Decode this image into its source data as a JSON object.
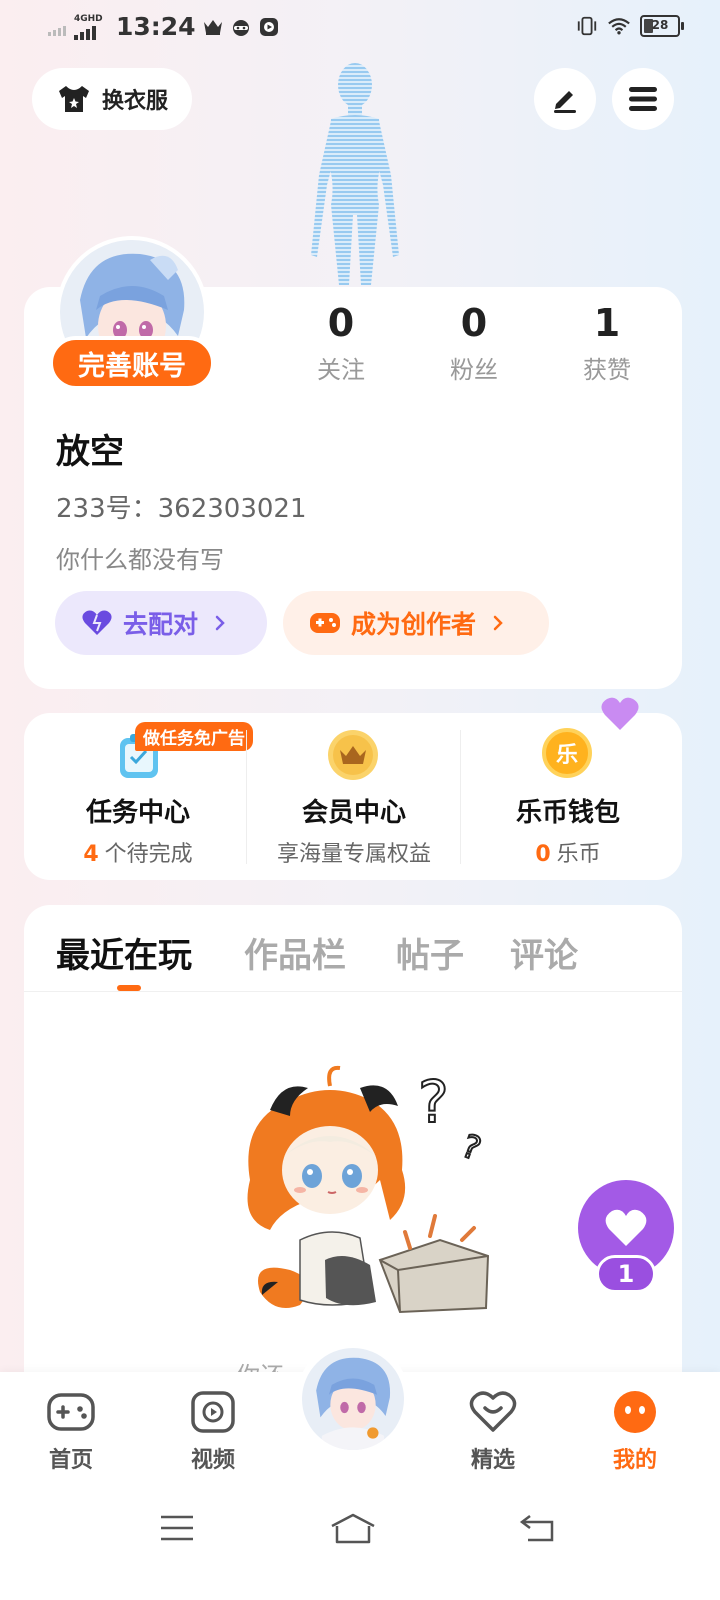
{
  "status_bar": {
    "network_type": "4GHD",
    "time": "13:24",
    "battery": "28",
    "icons": [
      "crown-icon",
      "ninja-icon",
      "play-icon",
      "vibrate-icon",
      "wifi-icon",
      "battery-icon"
    ]
  },
  "top_actions": {
    "outfit_label": "换衣服",
    "edit_icon": "pen-icon",
    "menu_icon": "menu-icon"
  },
  "profile": {
    "complete_badge": "完善账号",
    "stats": [
      {
        "value": "0",
        "label": "关注"
      },
      {
        "value": "0",
        "label": "粉丝"
      },
      {
        "value": "1",
        "label": "获赞"
      }
    ],
    "username": "放空",
    "uid": "233号：362303021",
    "bio": "你什么都没有写",
    "pair_label": "去配对",
    "creator_label": "成为创作者"
  },
  "services": {
    "task_badge": "做任务免广告",
    "items": [
      {
        "title": "任务中心",
        "count": "4",
        "sub": "个待完成"
      },
      {
        "title": "会员中心",
        "count": "",
        "sub": "享海量专属权益"
      },
      {
        "title": "乐币钱包",
        "count": "0",
        "sub": "乐币"
      }
    ],
    "coin_glyph": "乐"
  },
  "tabs": [
    "最近在玩",
    "作品栏",
    "帖子",
    "评论"
  ],
  "active_tab": 0,
  "empty_state_partial": "你还",
  "floating_like": {
    "count": "1"
  },
  "bottom_nav": [
    {
      "label": "首页",
      "icon": "gamepad-icon"
    },
    {
      "label": "视频",
      "icon": "video-play-icon"
    },
    {
      "label": "精选",
      "icon": "heart-chat-icon"
    },
    {
      "label": "我的",
      "icon": "face-icon"
    }
  ],
  "colors": {
    "accent": "#ff6a12",
    "purple": "#7a5ee8",
    "like_purple": "#a35ae6"
  }
}
